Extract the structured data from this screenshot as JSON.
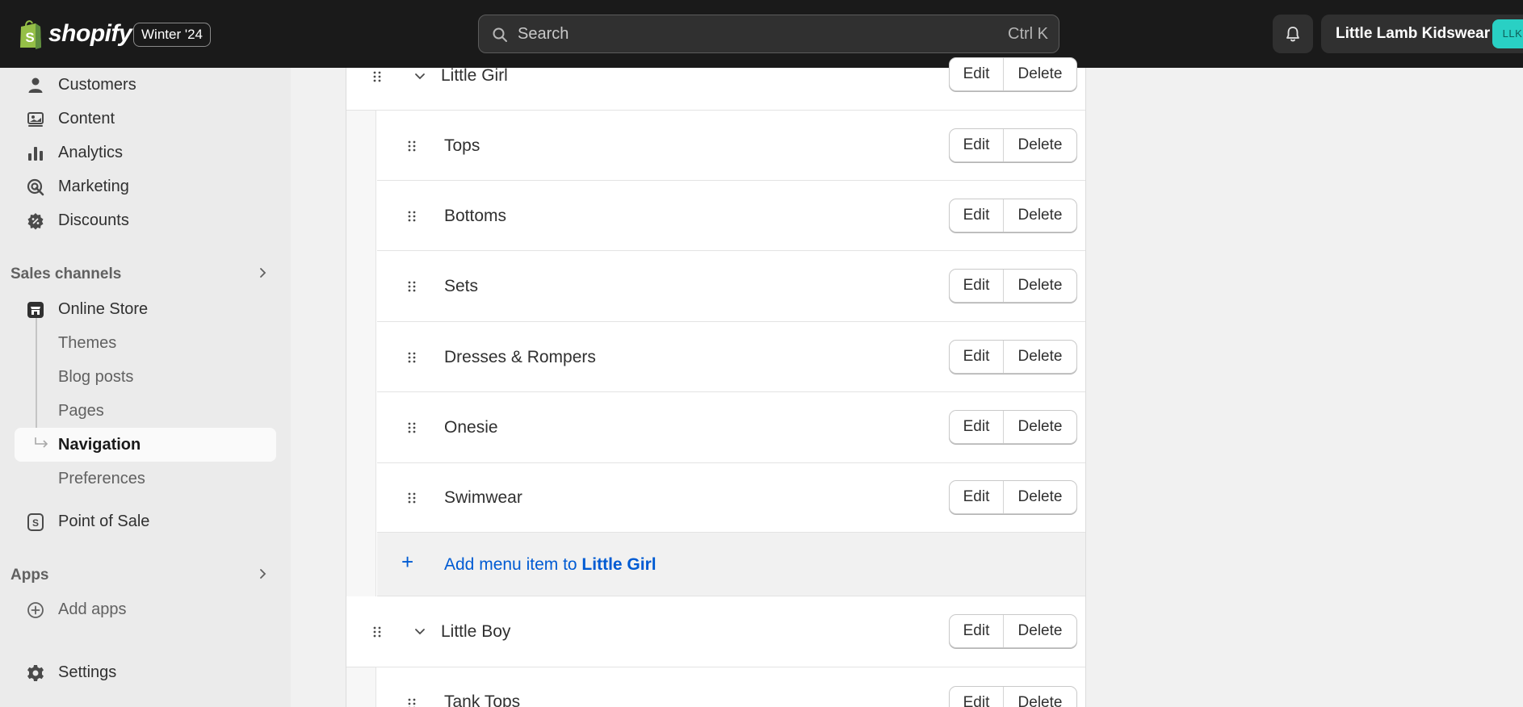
{
  "topbar": {
    "brand": "shopify",
    "version_badge": "Winter '24",
    "search_placeholder": "Search",
    "search_shortcut": "Ctrl K",
    "store_name": "Little Lamb Kidswear",
    "store_initials": "LLK"
  },
  "sidebar": {
    "items": [
      {
        "label": "Customers",
        "icon": "person-icon"
      },
      {
        "label": "Content",
        "icon": "content-icon"
      },
      {
        "label": "Analytics",
        "icon": "analytics-icon"
      },
      {
        "label": "Marketing",
        "icon": "marketing-icon"
      },
      {
        "label": "Discounts",
        "icon": "discount-icon"
      }
    ],
    "sales_channels_label": "Sales channels",
    "online_store_label": "Online Store",
    "online_store_subitems": [
      "Themes",
      "Blog posts",
      "Pages",
      "Navigation",
      "Preferences"
    ],
    "active_subitem": "Navigation",
    "pos_label": "Point of Sale",
    "apps_label": "Apps",
    "add_apps_label": "Add apps",
    "settings_label": "Settings"
  },
  "menu": {
    "edit_label": "Edit",
    "delete_label": "Delete",
    "parent_1": "Little Girl",
    "children_1": [
      "Tops",
      "Bottoms",
      "Sets",
      "Dresses & Rompers",
      "Onesie",
      "Swimwear"
    ],
    "add_item_prefix": "Add menu item to ",
    "add_item_target": "Little Girl",
    "parent_2": "Little Boy",
    "children_2": [
      "Tank Tops"
    ]
  }
}
